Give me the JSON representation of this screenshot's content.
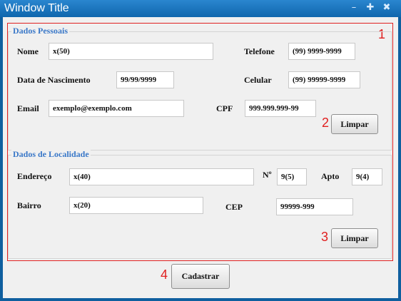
{
  "window": {
    "title": "Window Title"
  },
  "icons": {
    "minimize": "minimize-icon",
    "maximize": "maximize-icon",
    "close": "close-icon"
  },
  "colors": {
    "titlebar": "#1a76c0",
    "annotation": "#e02020",
    "group_title": "#3a78c8"
  },
  "pessoais": {
    "title": "Dados Pessoais",
    "nome_label": "Nome",
    "nome_value": "x(50)",
    "telefone_label": "Telefone",
    "telefone_value": "(99) 9999-9999",
    "nascimento_label": "Data de Nascimento",
    "nascimento_value": "99/99/9999",
    "celular_label": "Celular",
    "celular_value": "(99) 99999-9999",
    "email_label": "Email",
    "email_value": "exemplo@exemplo.com",
    "cpf_label": "CPF",
    "cpf_value": "999.999.999-99",
    "limpar_label": "Limpar"
  },
  "localidade": {
    "title": "Dados de Localidade",
    "endereco_label": "Endereço",
    "endereco_value": "x(40)",
    "numero_label": "Nº",
    "numero_value": "9(5)",
    "apto_label": "Apto",
    "apto_value": "9(4)",
    "bairro_label": "Bairro",
    "bairro_value": "x(20)",
    "cep_label": "CEP",
    "cep_value": "99999-999",
    "limpar_label": "Limpar"
  },
  "cadastrar_label": "Cadastrar",
  "annotations": [
    "1",
    "2",
    "3",
    "4"
  ]
}
